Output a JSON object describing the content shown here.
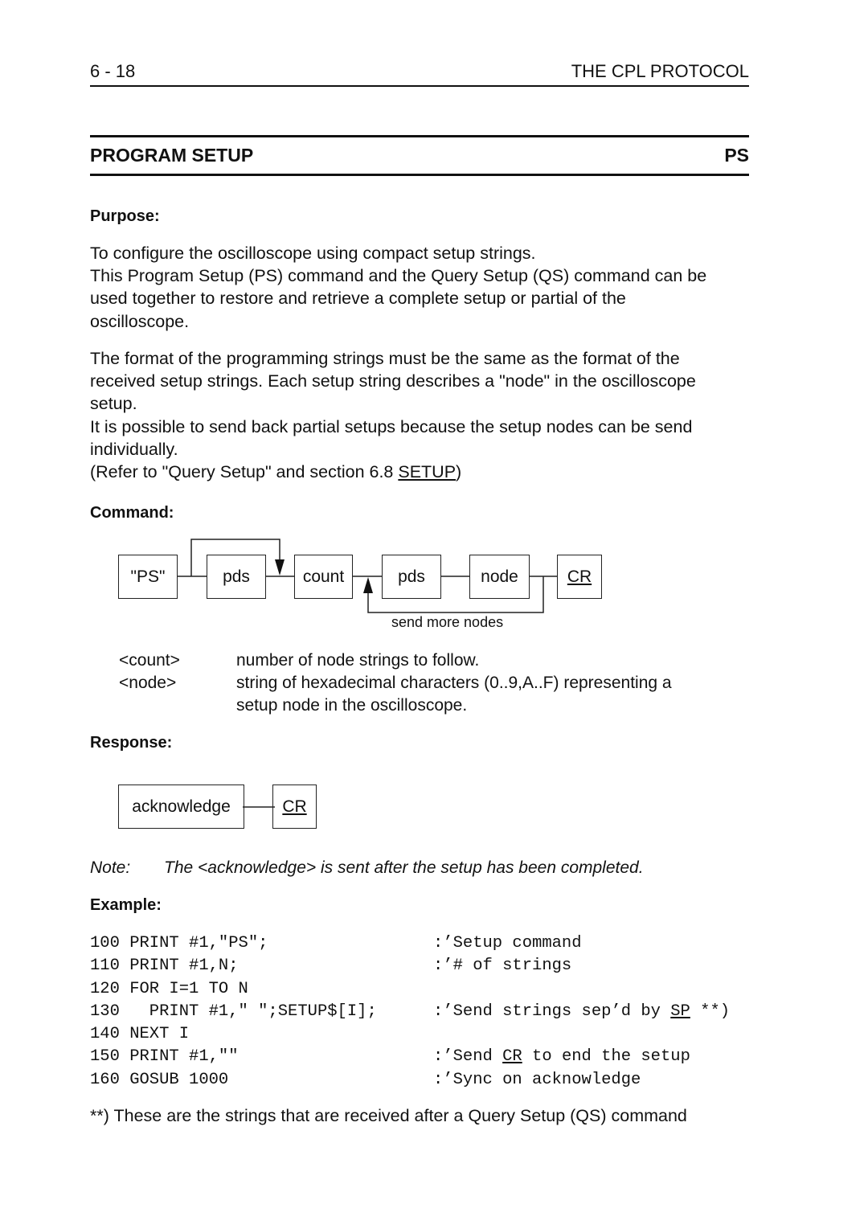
{
  "header": {
    "page_number": "6 - 18",
    "chapter": "THE CPL PROTOCOL"
  },
  "section": {
    "title": "PROGRAM SETUP",
    "code": "PS"
  },
  "purpose": {
    "heading": "Purpose:",
    "lines1": [
      "To configure the oscilloscope using compact setup strings.",
      "This Program Setup (PS) command and the Query Setup (QS) command can be",
      "used together to restore and retrieve a complete setup or partial of the",
      "oscilloscope."
    ],
    "lines2": [
      "The format of the programming strings must be the same as the format of the",
      "received setup strings. Each setup string describes a \"node\" in the oscilloscope",
      "setup.",
      "It is possible to send back partial setups because the setup nodes can be send",
      "individually."
    ],
    "refer_prefix": "(Refer to \"Query Setup\" and section 6.8 ",
    "refer_link": "SETUP",
    "refer_suffix": ")"
  },
  "command": {
    "heading": "Command:",
    "boxes": [
      "\"PS\"",
      "pds",
      "count",
      "pds",
      "node",
      "CR"
    ],
    "loop_label": "send more nodes",
    "definitions": [
      {
        "term": "<count>",
        "desc": [
          "number of node strings to follow."
        ]
      },
      {
        "term": "<node>",
        "desc": [
          "string of hexadecimal characters (0..9,A..F) representing a",
          "setup node in the oscilloscope."
        ]
      }
    ]
  },
  "response": {
    "heading": "Response:",
    "boxes": [
      "acknowledge",
      "CR"
    ]
  },
  "note": {
    "label": "Note:",
    "text": "The <acknowledge> is sent after the setup has been completed."
  },
  "example": {
    "heading": "Example:",
    "lines": [
      {
        "code": "100 PRINT #1,\"PS\";",
        "comment": ":’Setup command"
      },
      {
        "code": "110 PRINT #1,N;",
        "comment": ":’# of strings"
      },
      {
        "code": "120 FOR I=1 TO N",
        "comment": ""
      },
      {
        "code": "130   PRINT #1,\" \";SETUP$[I];",
        "comment_pre": ":’Send strings sep’d by ",
        "comment_u": "SP",
        "comment_post": " **)"
      },
      {
        "code": "140 NEXT I",
        "comment": ""
      },
      {
        "code": "150 PRINT #1,\"\"",
        "comment_pre": ":’Send ",
        "comment_u": "CR",
        "comment_post": " to end the setup"
      },
      {
        "code": "160 GOSUB 1000",
        "comment": ":’Sync on acknowledge"
      }
    ]
  },
  "footnote": "**) These are the strings that are received after a Query Setup (QS) command"
}
